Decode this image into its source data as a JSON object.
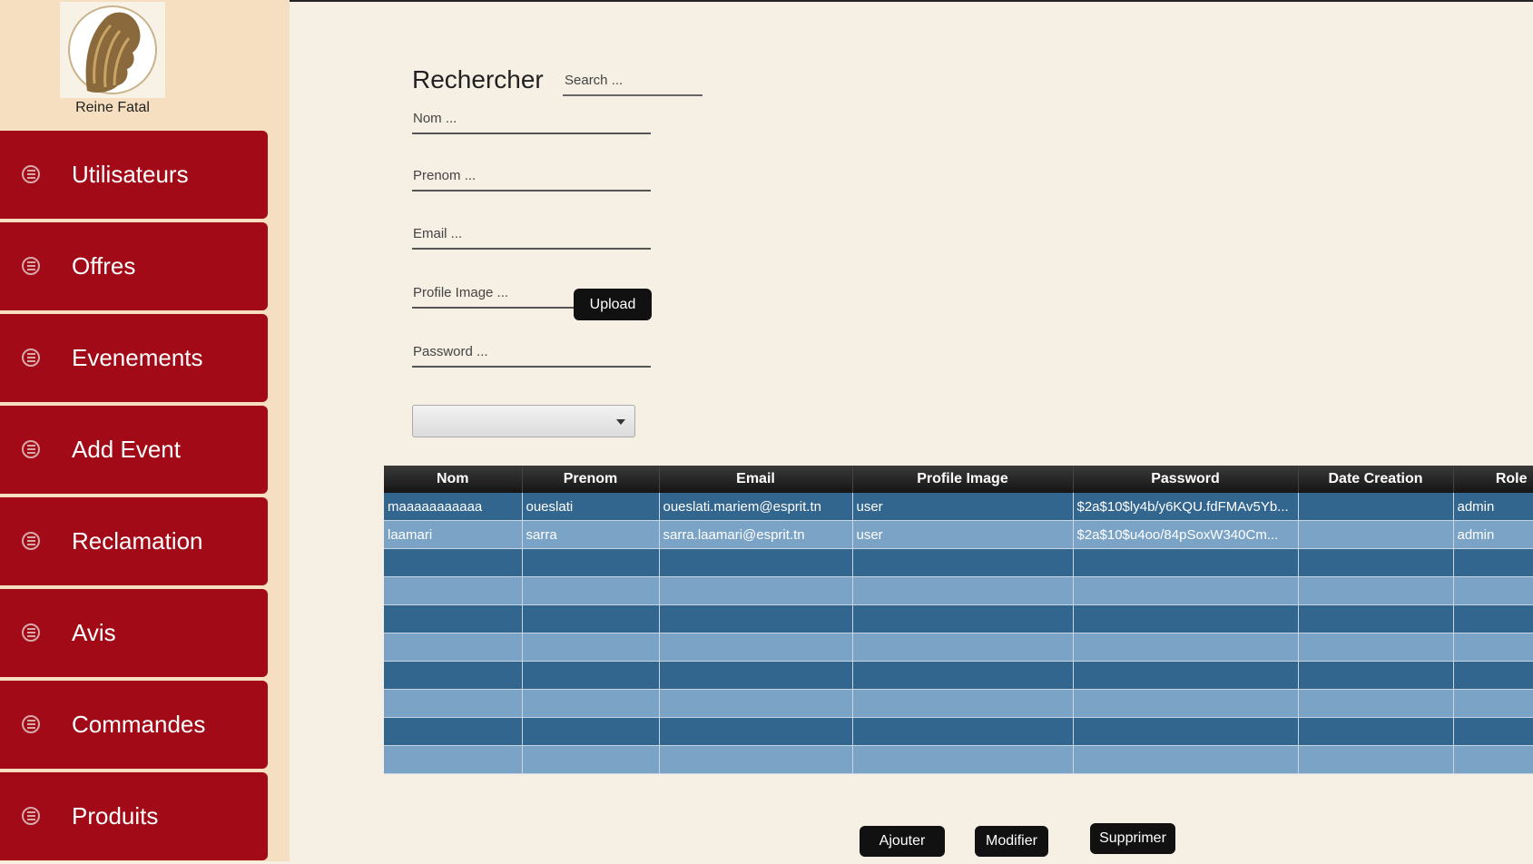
{
  "app": {
    "brand": "Reine Fatal"
  },
  "sidebar": {
    "items": [
      {
        "label": "Utilisateurs"
      },
      {
        "label": "Offres"
      },
      {
        "label": "Evenements"
      },
      {
        "label": "Add Event"
      },
      {
        "label": "Reclamation"
      },
      {
        "label": "Avis"
      },
      {
        "label": "Commandes"
      },
      {
        "label": "Produits"
      }
    ]
  },
  "form": {
    "title": "Rechercher",
    "search_placeholder": "Search ...",
    "nom_placeholder": "Nom ...",
    "prenom_placeholder": "Prenom ...",
    "email_placeholder": "Email ...",
    "profile_image_placeholder": "Profile Image ...",
    "password_placeholder": "Password ...",
    "upload_label": "Upload",
    "role_select_value": ""
  },
  "table": {
    "columns": [
      "Nom",
      "Prenom",
      "Email",
      "Profile Image",
      "Password",
      "Date Creation",
      "Role"
    ],
    "rows": [
      [
        "maaaaaaaaaaa",
        "oueslati",
        "oueslati.mariem@esprit.tn",
        "user",
        "$2a$10$ly4b/y6KQU.fdFMAv5Yb...",
        "",
        "admin"
      ],
      [
        "laamari",
        "sarra",
        "sarra.laamari@esprit.tn",
        "user",
        "$2a$10$u4oo/84pSoxW340Cm...",
        "",
        "admin"
      ]
    ]
  },
  "actions": {
    "ajouter": "Ajouter",
    "modifier": "Modifier",
    "supprimer": "Supprimer"
  },
  "colors": {
    "sidebar_bg": "#f6dfc0",
    "nav_red": "#a10a16",
    "page_bg": "#f6efe3",
    "row_dark": "#33668f",
    "row_light": "#7aa3c5"
  }
}
